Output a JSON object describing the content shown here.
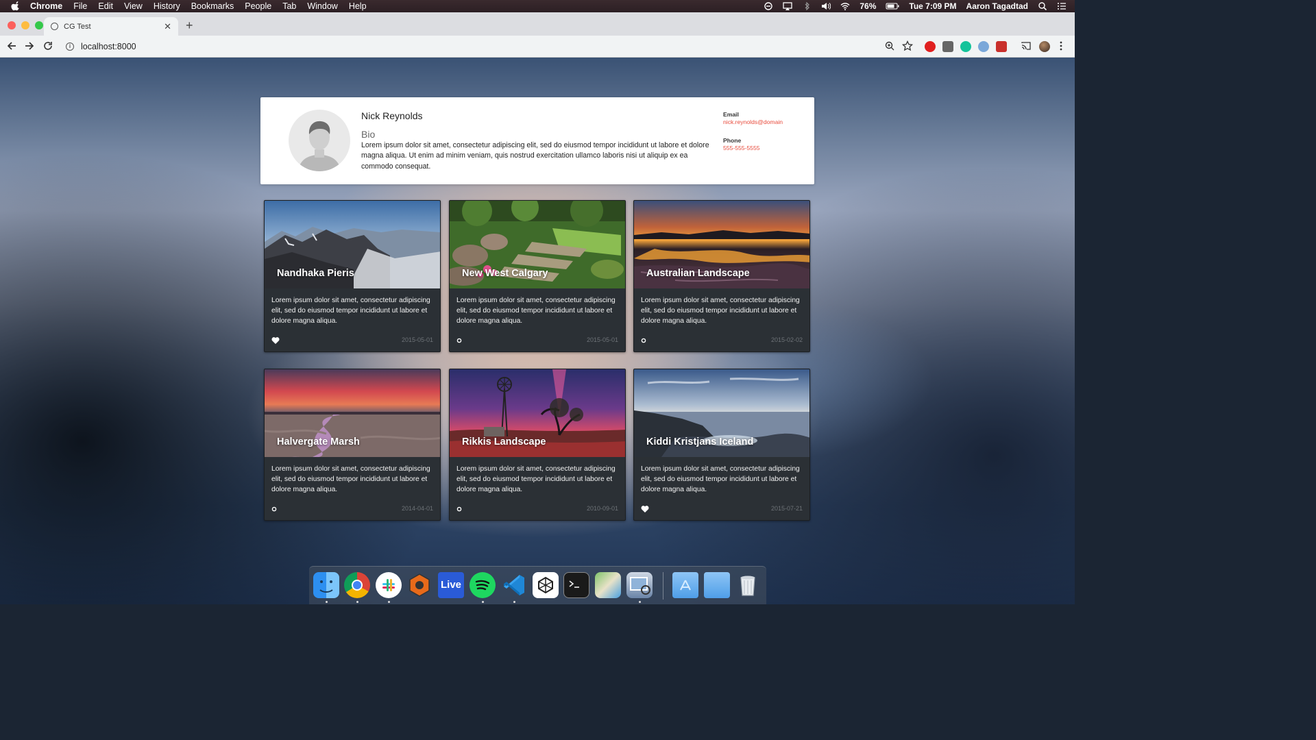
{
  "menubar": {
    "app": "Chrome",
    "menus": [
      "File",
      "Edit",
      "View",
      "History",
      "Bookmarks",
      "People",
      "Tab",
      "Window",
      "Help"
    ],
    "battery": "76%",
    "clock": "Tue 7:09 PM",
    "user": "Aaron Tagadtad"
  },
  "browser": {
    "tab_title": "CG Test",
    "url": "localhost:8000"
  },
  "profile": {
    "name": "Nick Reynolds",
    "bio_heading": "Bio",
    "bio": "Lorem ipsum dolor sit amet, consectetur adipiscing elit, sed do eiusmod tempor incididunt ut labore et dolore magna aliqua. Ut enim ad minim veniam, quis nostrud exercitation ullamco laboris nisi ut aliquip ex ea commodo consequat.",
    "email_label": "Email",
    "email": "nick.reynolds@domain",
    "phone_label": "Phone",
    "phone": "555-555-5555"
  },
  "cards": [
    {
      "title": "Nandhaka Pieris",
      "text": "Lorem ipsum dolor sit amet, consectetur adipiscing elit, sed do eiusmod tempor incididunt ut labore et dolore magna aliqua.",
      "date": "2015-05-01",
      "favorited": true,
      "image": "mountains"
    },
    {
      "title": "New West Calgary",
      "text": "Lorem ipsum dolor sit amet, consectetur adipiscing elit, sed do eiusmod tempor incididunt ut labore et dolore magna aliqua.",
      "date": "2015-05-01",
      "favorited": false,
      "image": "garden"
    },
    {
      "title": "Australian Landscape",
      "text": "Lorem ipsum dolor sit amet, consectetur adipiscing elit, sed do eiusmod tempor incididunt ut labore et dolore magna aliqua.",
      "date": "2015-02-02",
      "favorited": false,
      "image": "sunset-beach"
    },
    {
      "title": "Halvergate Marsh",
      "text": "Lorem ipsum dolor sit amet, consectetur adipiscing elit, sed do eiusmod tempor incididunt ut labore et dolore magna aliqua.",
      "date": "2014-04-01",
      "favorited": false,
      "image": "marsh"
    },
    {
      "title": "Rikkis Landscape",
      "text": "Lorem ipsum dolor sit amet, consectetur adipiscing elit, sed do eiusmod tempor incididunt ut labore et dolore magna aliqua.",
      "date": "2010-09-01",
      "favorited": false,
      "image": "windmill"
    },
    {
      "title": "Kiddi Kristjans Iceland",
      "text": "Lorem ipsum dolor sit amet, consectetur adipiscing elit, sed do eiusmod tempor incididunt ut labore et dolore magna aliqua.",
      "date": "2015-07-21",
      "favorited": true,
      "image": "iceland-coast"
    }
  ],
  "dock": {
    "apps": [
      "finder-icon",
      "chrome-icon",
      "slack-icon",
      "reason-icon",
      "live-icon",
      "spotify-icon",
      "vscode-icon",
      "unity-icon",
      "terminal-icon",
      "maps-icon",
      "preview-icon",
      "appstore-folder-icon",
      "folder-icon",
      "trash-icon"
    ],
    "live_label": "Live"
  },
  "colors": {
    "accent": "#e84c3d",
    "card_bg": "#2b3035"
  }
}
